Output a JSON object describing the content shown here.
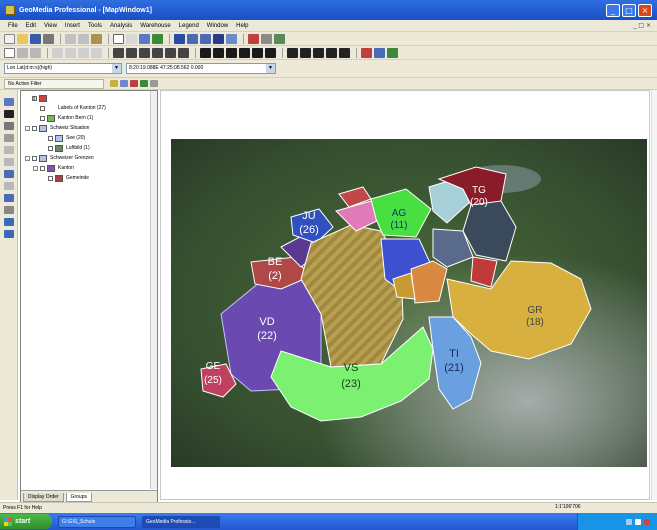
{
  "window": {
    "title": "GeoMedia Professional - [MapWindow1]"
  },
  "menu": [
    "File",
    "Edit",
    "View",
    "Insert",
    "Tools",
    "Analysis",
    "Warehouse",
    "Legend",
    "Window",
    "Help"
  ],
  "address_bar": {
    "coordsys": "Lon Lat(d:m:s)(high)",
    "coord_readout": "8:20:19.088E 47:25:08.562 0.000"
  },
  "filter": {
    "label": "No Active Filter"
  },
  "legend_tree": [
    {
      "indent": 0,
      "expander": "",
      "check": "x",
      "label": "",
      "icon": "#d04040"
    },
    {
      "indent": 1,
      "expander": "",
      "check": "",
      "label": "Labels of Kanton (27)",
      "icon": ""
    },
    {
      "indent": 1,
      "expander": "",
      "check": "",
      "label": "Kanton Bern (1)",
      "icon": "#78b85c"
    },
    {
      "indent": 0,
      "expander": "-",
      "check": "",
      "label": "Schweiz Situation",
      "icon": "#b0c4e8"
    },
    {
      "indent": 2,
      "expander": "",
      "check": "",
      "label": "See (20)",
      "icon": "#a8c8f0"
    },
    {
      "indent": 2,
      "expander": "",
      "check": "",
      "label": "Luftbild (1)",
      "icon": "#6a8a60"
    },
    {
      "indent": 0,
      "expander": "-",
      "check": "",
      "label": "Schweizer Grenzen",
      "icon": "#b0c4e8"
    },
    {
      "indent": 1,
      "expander": "-",
      "check": "",
      "label": "Kanton",
      "icon": "#7a5aa8"
    },
    {
      "indent": 2,
      "expander": "",
      "check": "",
      "label": "Gemeinde",
      "icon": "#a84040"
    }
  ],
  "panel_tabs": [
    "Display Order",
    "Groups"
  ],
  "status": {
    "help": "Press F1 for Help",
    "scale": "1:1'106'706"
  },
  "taskbar": {
    "start": "start",
    "tasks": [
      "G:\\GIS_Schule",
      "GeoMedia Professio..."
    ],
    "clock": ""
  },
  "map_labels": [
    {
      "code": "JU",
      "count": "(26)",
      "color": "#ffffff"
    },
    {
      "code": "AG",
      "count": "(11)",
      "color": "#1a2a7a"
    },
    {
      "code": "TG",
      "count": "(20)",
      "color": "#ffffff"
    },
    {
      "code": "BE",
      "count": "(2)",
      "color": "#ffffff"
    },
    {
      "code": "VD",
      "count": "(22)",
      "color": "#ffffff"
    },
    {
      "code": "GR",
      "count": "(18)",
      "color": "#444444"
    },
    {
      "code": "VS",
      "count": "(23)",
      "color": "#1a3a1a"
    },
    {
      "code": "TI",
      "count": "(21)",
      "color": "#1a2a5a"
    },
    {
      "code": "GE",
      "count": "(25)",
      "color": "#ffffff"
    }
  ],
  "colors": {
    "aerial_base": "#3e5a3a",
    "VD": "#6a4ab0",
    "VS": "#7cf070",
    "BE": "#c8a040",
    "AG": "#48e040",
    "TG": "#8a1c2a",
    "GR": "#d8b040",
    "TI": "#6aa0e0",
    "JU": "#3050c0",
    "GE": "#c04060",
    "LU": "#3d50d0",
    "FR": "#b04848",
    "SO": "#e07ab8",
    "ZH": "#a8d0d8"
  }
}
